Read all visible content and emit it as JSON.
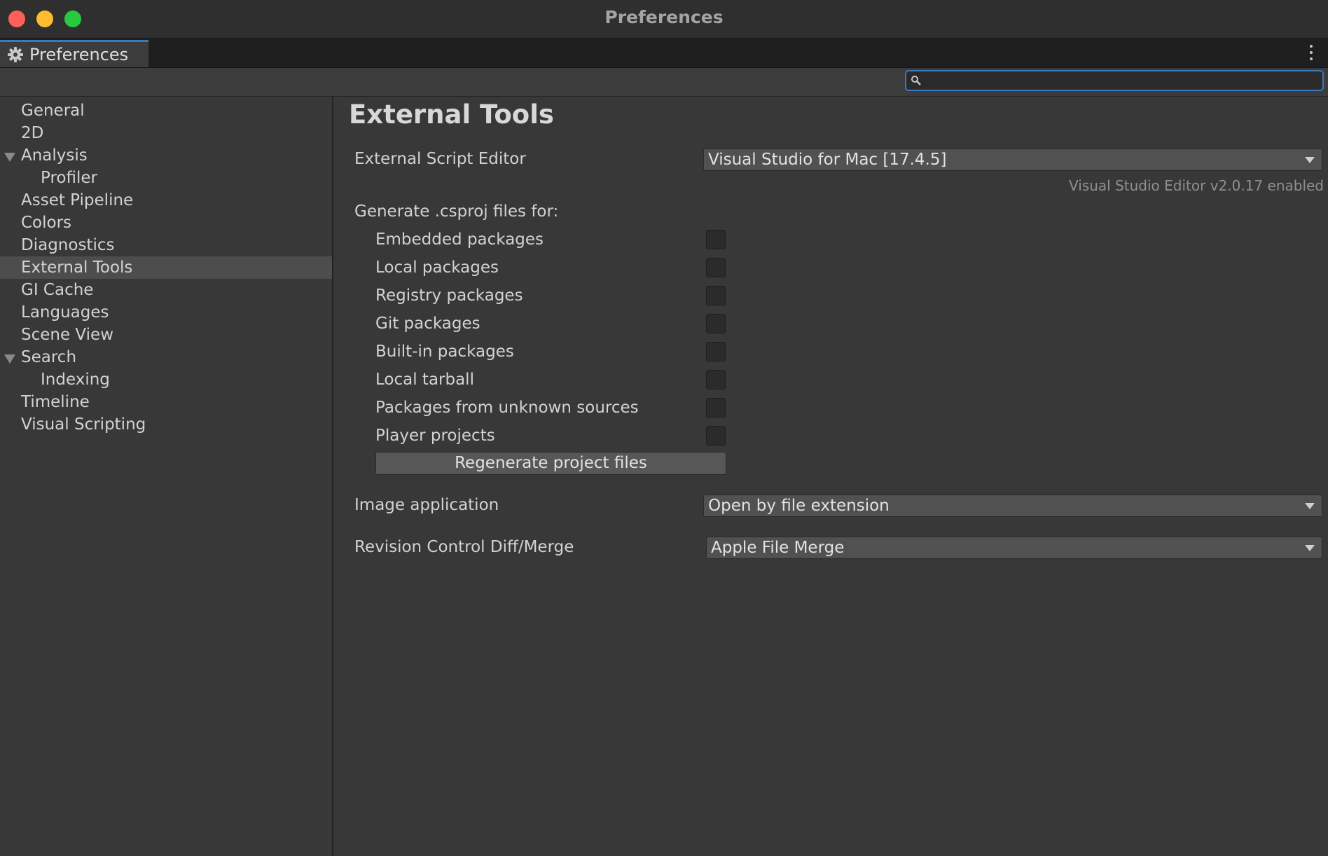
{
  "window": {
    "title": "Preferences"
  },
  "tab": {
    "label": "Preferences",
    "icon": "gear-icon"
  },
  "search": {
    "value": "",
    "placeholder": ""
  },
  "sidebar": {
    "items": [
      {
        "label": "General"
      },
      {
        "label": "2D"
      },
      {
        "label": "Analysis",
        "expanded": true
      },
      {
        "label": "Profiler"
      },
      {
        "label": "Asset Pipeline"
      },
      {
        "label": "Colors"
      },
      {
        "label": "Diagnostics"
      },
      {
        "label": "External Tools",
        "selected": true
      },
      {
        "label": "GI Cache"
      },
      {
        "label": "Languages"
      },
      {
        "label": "Scene View"
      },
      {
        "label": "Search",
        "expanded": true
      },
      {
        "label": "Indexing"
      },
      {
        "label": "Timeline"
      },
      {
        "label": "Visual Scripting"
      }
    ]
  },
  "main": {
    "title": "External Tools",
    "script_editor": {
      "label": "External Script Editor",
      "value": "Visual Studio for Mac [17.4.5]",
      "hint": "Visual Studio Editor v2.0.17 enabled"
    },
    "csproj": {
      "label": "Generate .csproj files for:",
      "options": [
        {
          "label": "Embedded packages",
          "checked": false
        },
        {
          "label": "Local packages",
          "checked": false
        },
        {
          "label": "Registry packages",
          "checked": false
        },
        {
          "label": "Git packages",
          "checked": false
        },
        {
          "label": "Built-in packages",
          "checked": false
        },
        {
          "label": "Local tarball",
          "checked": false
        },
        {
          "label": "Packages from unknown sources",
          "checked": false
        },
        {
          "label": "Player projects",
          "checked": false
        }
      ],
      "regenerate_label": "Regenerate project files"
    },
    "image_application": {
      "label": "Image application",
      "value": "Open by file extension"
    },
    "revision_control": {
      "label": "Revision Control Diff/Merge",
      "value": "Apple File Merge"
    }
  },
  "colors": {
    "accent": "#3a79bb",
    "background": "#383838",
    "selected": "#4d4d4d"
  }
}
